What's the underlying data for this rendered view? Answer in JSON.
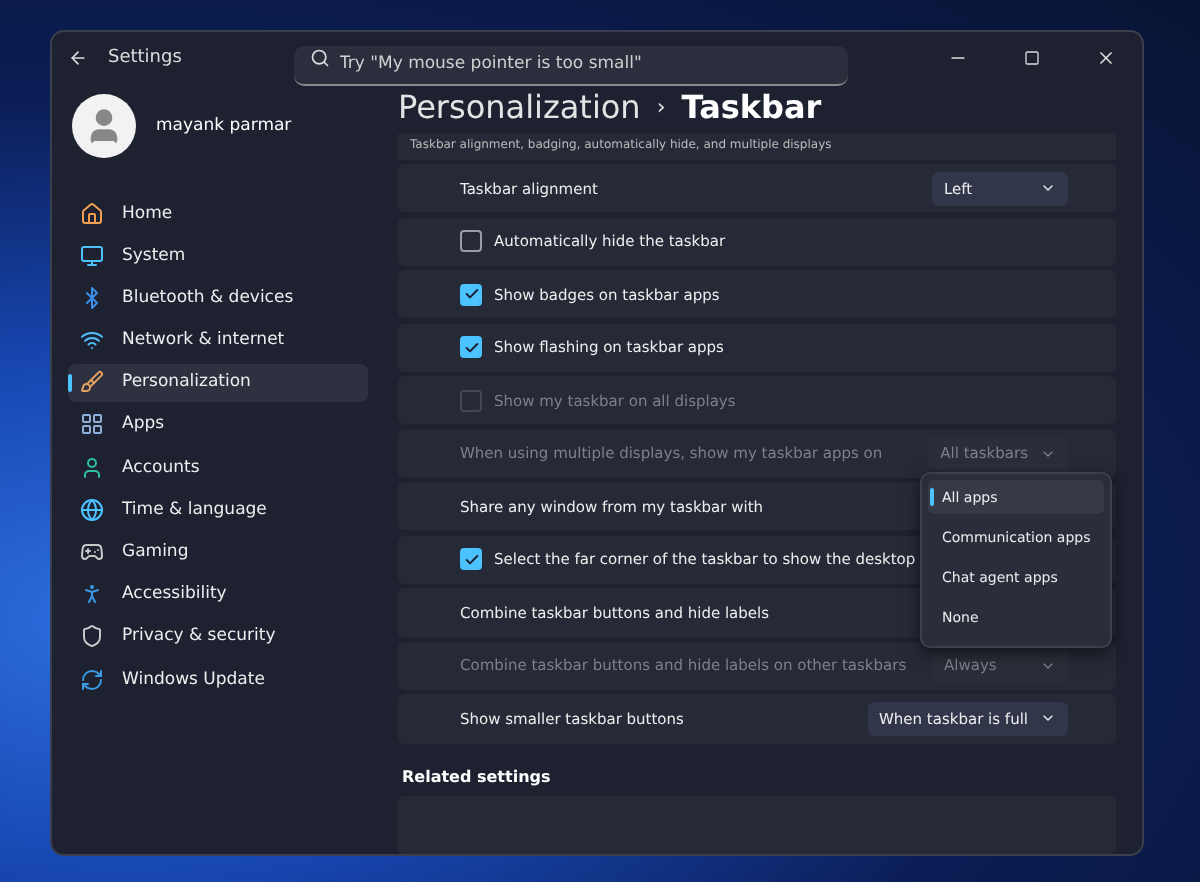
{
  "window": {
    "title": "Settings"
  },
  "search": {
    "placeholder": "Try \"My mouse pointer is too small\""
  },
  "user": {
    "name": "mayank parmar"
  },
  "sidebar": {
    "items": [
      {
        "label": "Home",
        "selected": false
      },
      {
        "label": "System",
        "selected": false
      },
      {
        "label": "Bluetooth & devices",
        "selected": false
      },
      {
        "label": "Network & internet",
        "selected": false
      },
      {
        "label": "Personalization",
        "selected": true
      },
      {
        "label": "Apps",
        "selected": false
      },
      {
        "label": "Accounts",
        "selected": false
      },
      {
        "label": "Time & language",
        "selected": false
      },
      {
        "label": "Gaming",
        "selected": false
      },
      {
        "label": "Accessibility",
        "selected": false
      },
      {
        "label": "Privacy & security",
        "selected": false
      },
      {
        "label": "Windows Update",
        "selected": false
      }
    ]
  },
  "breadcrumb": {
    "parent": "Personalization",
    "separator": "›",
    "current": "Taskbar"
  },
  "section": {
    "description": "Taskbar alignment, badging, automatically hide, and multiple displays",
    "rows": [
      {
        "kind": "dropdown",
        "label": "Taskbar alignment",
        "value": "Left",
        "disabled": false
      },
      {
        "kind": "checkbox",
        "label": "Automatically hide the taskbar",
        "checked": false,
        "disabled": false
      },
      {
        "kind": "checkbox",
        "label": "Show badges on taskbar apps",
        "checked": true,
        "disabled": false
      },
      {
        "kind": "checkbox",
        "label": "Show flashing on taskbar apps",
        "checked": true,
        "disabled": false
      },
      {
        "kind": "checkbox",
        "label": "Show my taskbar on all displays",
        "checked": false,
        "disabled": true
      },
      {
        "kind": "dropdown",
        "label": "When using multiple displays, show my taskbar apps on",
        "value": "All taskbars",
        "disabled": true
      },
      {
        "kind": "menu",
        "label": "Share any window from my taskbar with",
        "disabled": false,
        "options": [
          {
            "label": "All apps",
            "selected": true
          },
          {
            "label": "Communication apps",
            "selected": false
          },
          {
            "label": "Chat agent apps",
            "selected": false
          },
          {
            "label": "None",
            "selected": false
          }
        ]
      },
      {
        "kind": "checkbox",
        "label": "Select the far corner of the taskbar to show the desktop",
        "checked": true,
        "disabled": false
      },
      {
        "kind": "plain",
        "label": "Combine taskbar buttons and hide labels",
        "disabled": false
      },
      {
        "kind": "dropdown",
        "label": "Combine taskbar buttons and hide labels on other taskbars",
        "value": "Always",
        "disabled": true
      },
      {
        "kind": "dropdown",
        "label": "Show smaller taskbar buttons",
        "value": "When taskbar is full",
        "disabled": false
      }
    ]
  },
  "related": {
    "title": "Related settings"
  }
}
